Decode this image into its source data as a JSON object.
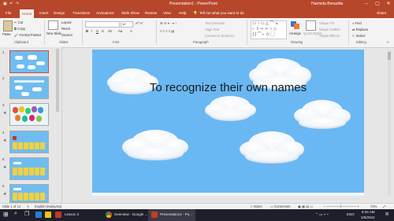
{
  "titlebar": {
    "autosave_icon": "save-icon",
    "title": "Presentation1 - PowerPoint",
    "user": "Harmida Benadda",
    "min": "–",
    "max": "▢",
    "close": "✕"
  },
  "tabs": [
    {
      "label": "File"
    },
    {
      "label": "Home"
    },
    {
      "label": "Insert"
    },
    {
      "label": "Design"
    },
    {
      "label": "Transitions"
    },
    {
      "label": "Animations"
    },
    {
      "label": "Slide Show"
    },
    {
      "label": "Review"
    },
    {
      "label": "View"
    },
    {
      "label": "Help"
    }
  ],
  "tell_me": "Tell me what you want to do",
  "share": "Share",
  "ribbon": {
    "paste": "Paste",
    "cut": "Cut",
    "copy": "Copy",
    "format_painter": "Format Painter",
    "clipboard": "Clipboard",
    "new_slide": "New Slide",
    "layout": "Layout",
    "reset": "Reset",
    "section": "Section",
    "slides": "Slides",
    "font_size": "12",
    "font": "Font",
    "text_direction": "Text Direction",
    "align_text": "Align Text",
    "convert_smartart": "Convert to SmartArt",
    "paragraph": "Paragraph",
    "arrange": "Arrange",
    "quick_styles": "Quick Styles",
    "shape_fill": "Shape Fill",
    "shape_outline": "Shape Outline",
    "shape_effects": "Shape Effects",
    "drawing": "Drawing",
    "find": "Find",
    "replace": "Replace",
    "select": "Select",
    "editing": "Editing"
  },
  "slides": [
    {
      "num": "1"
    },
    {
      "num": "2"
    },
    {
      "num": "3"
    },
    {
      "num": "4"
    },
    {
      "num": "5"
    },
    {
      "num": "6"
    }
  ],
  "slide": {
    "title": "To recognize  their own names"
  },
  "status": {
    "slide_of": "Slide 1 of 14",
    "language": "English (Malaysia)",
    "notes": "Notes",
    "comments": "Comments",
    "zoom": "72%"
  },
  "taskbar": {
    "items": [
      {
        "label": "Lesson 2"
      },
      {
        "label": "Overview - Google ..."
      },
      {
        "label": "Presentation1 - Po..."
      }
    ],
    "lang": "ENG",
    "time": "8:26 AM",
    "date": "2/9/2023"
  },
  "colors": {
    "accent": "#b7472a",
    "slide_bg": "#6ab8f3",
    "taskbar": "#1f1f2b"
  }
}
